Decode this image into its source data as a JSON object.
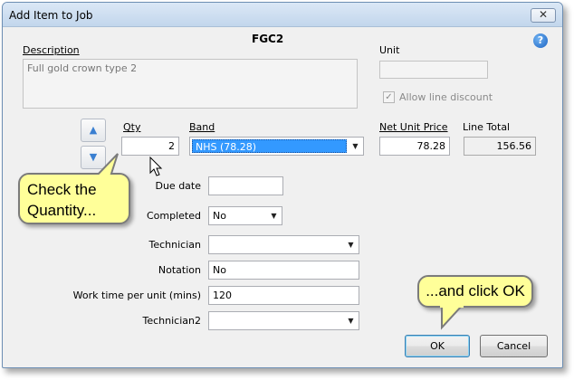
{
  "window": {
    "title": "Add Item to Job",
    "close_glyph": "✕"
  },
  "header": {
    "code": "FGC2",
    "help_glyph": "?"
  },
  "description": {
    "label": "Description",
    "value": "Full gold crown type 2"
  },
  "unit": {
    "label": "Unit",
    "value": ""
  },
  "allow_line_discount": {
    "label": "Allow line discount",
    "checked": true,
    "check_glyph": "✓"
  },
  "spin": {
    "up_glyph": "▲",
    "down_glyph": "▼"
  },
  "qty": {
    "label": "Qty",
    "value": "2"
  },
  "band": {
    "label": "Band",
    "value": "NHS  (78.28)"
  },
  "net_unit_price": {
    "label": "Net Unit Price",
    "value": "78.28"
  },
  "line_total": {
    "label": "Line Total",
    "value": "156.56"
  },
  "due_date": {
    "label": "Due date",
    "value": ""
  },
  "completed": {
    "label": "Completed",
    "value": "No"
  },
  "technician": {
    "label": "Technician",
    "value": ""
  },
  "notation": {
    "label": "Notation",
    "value": "No"
  },
  "work_time": {
    "label": "Work time per unit (mins)",
    "value": "120"
  },
  "technician2": {
    "label": "Technician2",
    "value": ""
  },
  "combo_glyph": "▼",
  "buttons": {
    "ok": "OK",
    "cancel": "Cancel"
  },
  "callouts": {
    "check_quantity": [
      "Check the",
      "Quantity..."
    ],
    "click_ok": "...and click OK"
  },
  "colors": {
    "band_selected_bg": "#3399ff",
    "callout_bg": "#ffff99",
    "accent": "#3a7fd1"
  },
  "icons": {
    "cursor": "mouse-pointer-icon",
    "help": "help-icon",
    "close": "close-icon"
  }
}
